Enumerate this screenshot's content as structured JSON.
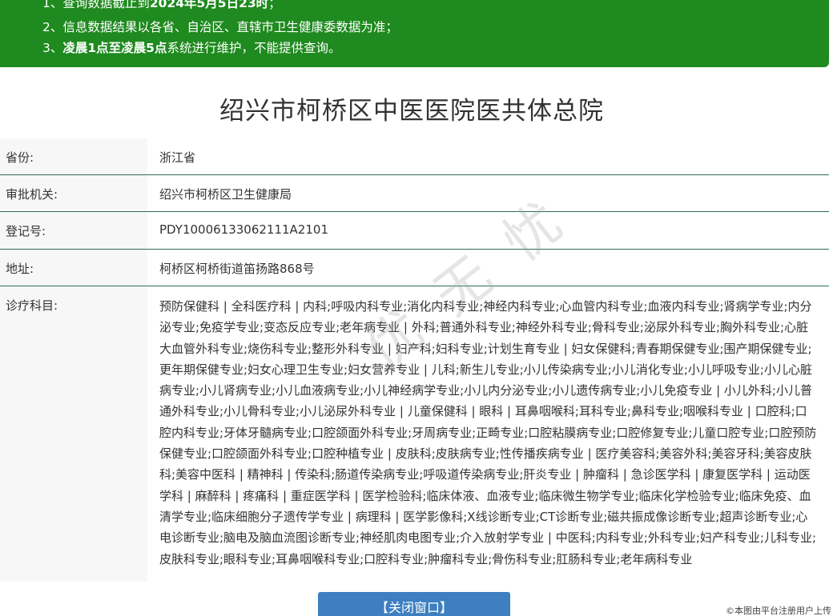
{
  "notice": {
    "line1_prefix": "1、查询数据截止到",
    "line1_bold": "2024年5月5日23时",
    "line1_suffix": "；",
    "line2": "2、信息数据结果以各省、自治区、直辖市卫生健康委数据为准；",
    "line3_prefix": "3、",
    "line3_bold": "凌晨1点至凌晨5点",
    "line3_suffix": "系统进行维护，不能提供查询。"
  },
  "title": "绍兴市柯桥区中医医院医共体总院",
  "fields": {
    "province_label": "省份:",
    "province_value": "浙江省",
    "authority_label": "审批机关:",
    "authority_value": "绍兴市柯桥区卫生健康局",
    "regno_label": "登记号:",
    "regno_value": "PDY10006133062111A2101",
    "address_label": "地址:",
    "address_value": "柯桥区柯桥街道笛扬路868号",
    "scope_label": "诊疗科目:",
    "scope_value": "预防保健科 | 全科医疗科 | 内科;呼吸内科专业;消化内科专业;神经内科专业;心血管内科专业;血液内科专业;肾病学专业;内分泌专业;免疫学专业;变态反应专业;老年病专业 | 外科;普通外科专业;神经外科专业;骨科专业;泌尿外科专业;胸外科专业;心脏大血管外科专业;烧伤科专业;整形外科专业 | 妇产科;妇科专业;计划生育专业 | 妇女保健科;青春期保健专业;围产期保健专业;更年期保健专业;妇女心理卫生专业;妇女营养专业 | 儿科;新生儿专业;小儿传染病专业;小儿消化专业;小儿呼吸专业;小儿心脏病专业;小儿肾病专业;小儿血液病专业;小儿神经病学专业;小儿内分泌专业;小儿遗传病专业;小儿免疫专业 | 小儿外科;小儿普通外科专业;小儿骨科专业;小儿泌尿外科专业 | 儿童保健科 | 眼科 | 耳鼻咽喉科;耳科专业;鼻科专业;咽喉科专业 | 口腔科;口腔内科专业;牙体牙髓病专业;口腔颌面外科专业;牙周病专业;正畸专业;口腔粘膜病专业;口腔修复专业;儿童口腔专业;口腔预防保健专业;口腔颌面外科专业;口腔种植专业 | 皮肤科;皮肤病专业;性传播疾病专业 | 医疗美容科;美容外科;美容牙科;美容皮肤科;美容中医科 | 精神科 | 传染科;肠道传染病专业;呼吸道传染病专业;肝炎专业 | 肿瘤科 | 急诊医学科 | 康复医学科 | 运动医学科 | 麻醉科 | 疼痛科 | 重症医学科 | 医学检验科;临床体液、血液专业;临床微生物学专业;临床化学检验专业;临床免疫、血清学专业;临床细胞分子遗传学专业 | 病理科 | 医学影像科;X线诊断专业;CT诊断专业;磁共振成像诊断专业;超声诊断专业;心电诊断专业;脑电及脑血流图诊断专业;神经肌肉电图专业;介入放射学专业 | 中医科;内科专业;外科专业;妇产科专业;儿科专业;皮肤科专业;眼科专业;耳鼻咽喉科专业;口腔科专业;肿瘤科专业;骨伤科专业;肛肠科专业;老年病科专业"
  },
  "watermark": "优 无 忧",
  "close_button": "【关闭窗口】",
  "footer_note": "©本图由平台注册用户上传",
  "colors": {
    "banner": "#1f8a1f",
    "row_divider": "#2f6b5e",
    "button": "#3d7fc1"
  }
}
